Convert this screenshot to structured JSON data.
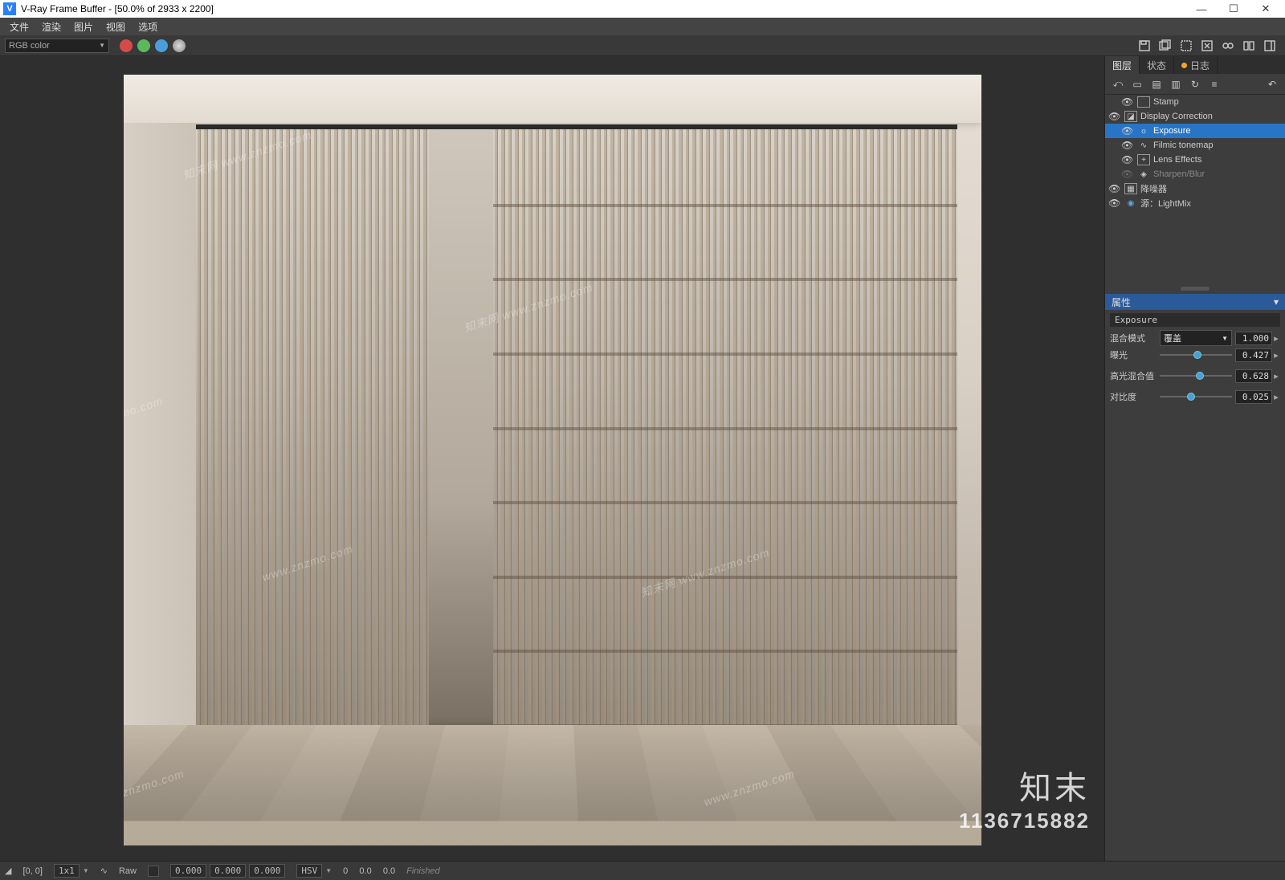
{
  "window": {
    "title": "V-Ray Frame Buffer - [50.0% of 2933 x 2200]"
  },
  "menubar": [
    "文件",
    "渲染",
    "图片",
    "视图",
    "选项"
  ],
  "channel_selector": "RGB color",
  "side": {
    "tabs": [
      "图层",
      "状态",
      "日志"
    ],
    "layers": [
      {
        "label": "Stamp",
        "indent": true
      },
      {
        "label": "Display Correction",
        "indent": false
      },
      {
        "label": "Exposure",
        "indent": true,
        "selected": true
      },
      {
        "label": "Filmic tonemap",
        "indent": true
      },
      {
        "label": "Lens Effects",
        "indent": true
      },
      {
        "label": "Sharpen/Blur",
        "indent": true
      },
      {
        "label": "降噪器",
        "indent": false
      },
      {
        "label": "源：LightMix",
        "indent": false
      }
    ],
    "props": {
      "title": "属性",
      "sub": "Exposure",
      "blend_label": "混合模式",
      "blend_value": "覆盖",
      "blend_num": "1.000",
      "sliders": [
        {
          "label": "曝光",
          "value": "0.427",
          "pos": 52
        },
        {
          "label": "高光混合值",
          "value": "0.628",
          "pos": 55
        },
        {
          "label": "对比度",
          "value": "0.025",
          "pos": 43
        }
      ]
    }
  },
  "status": {
    "coord": "[0, 0]",
    "scale": "1x1",
    "raw": "Raw",
    "rgb": [
      "0.000",
      "0.000",
      "0.000"
    ],
    "hsv": "HSV",
    "hsv_vals": [
      "0",
      "0.0",
      "0.0"
    ],
    "state": "Finished"
  },
  "watermark_logo": "知末",
  "watermark_id": "1136715882"
}
